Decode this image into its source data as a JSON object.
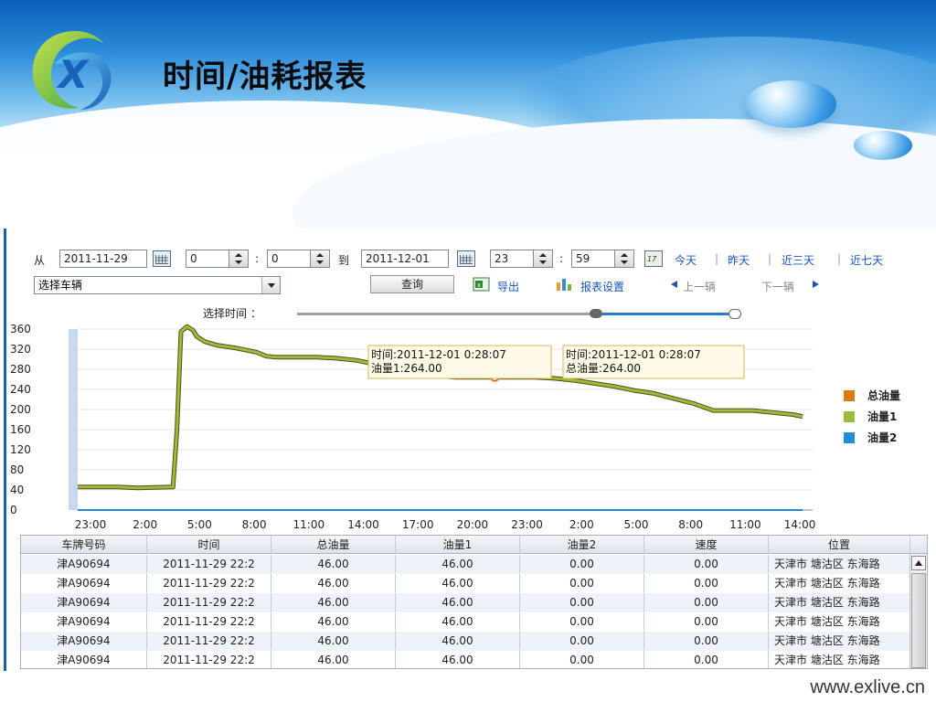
{
  "header": {
    "title": "时间/油耗报表",
    "logo_letter": "X"
  },
  "filter": {
    "from_label": "从",
    "start_date": "2011-11-29",
    "start_hour": "0",
    "start_minute": "0",
    "colon": ":",
    "to_label": "到",
    "end_date": "2011-12-01",
    "end_hour": "23",
    "end_minute": "59",
    "quick_links": [
      "今天",
      "昨天",
      "近三天",
      "近七天"
    ],
    "vehicle_placeholder": "选择车辆",
    "query_label": "查询",
    "export_label": "导出",
    "report_settings_label": "报表设置",
    "prev_vehicle_label": "上一辆",
    "next_vehicle_label": "下一辆",
    "time_slider_label": "选择时间 ："
  },
  "tooltips": [
    {
      "time": "时间:2011-12-01 0:28:07",
      "value": "油量1:264.00"
    },
    {
      "time": "时间:2011-12-01 0:28:07",
      "value": "总油量:264.00"
    }
  ],
  "chart_data": {
    "type": "line",
    "xlabels": [
      "23:00",
      "2:00",
      "5:00",
      "8:00",
      "11:00",
      "14:00",
      "17:00",
      "20:00",
      "23:00",
      "2:00",
      "5:00",
      "8:00",
      "11:00",
      "14:00"
    ],
    "yticks": [
      0,
      40,
      80,
      120,
      160,
      200,
      240,
      280,
      320,
      360
    ],
    "ylim": [
      0,
      360
    ],
    "legend_position": "right",
    "series": [
      {
        "name": "总油量",
        "color": "#e07b12",
        "values": [
          [
            0,
            46
          ],
          [
            1,
            46
          ],
          [
            2,
            46
          ],
          [
            3,
            44
          ],
          [
            4.8,
            46
          ],
          [
            5.0,
            160
          ],
          [
            5.2,
            355
          ],
          [
            5.5,
            365
          ],
          [
            5.8,
            358
          ],
          [
            6.0,
            345
          ],
          [
            6.4,
            335
          ],
          [
            7,
            328
          ],
          [
            8,
            322
          ],
          [
            9,
            314
          ],
          [
            9.5,
            306
          ],
          [
            10,
            304
          ],
          [
            11,
            304
          ],
          [
            12,
            304
          ],
          [
            13,
            302
          ],
          [
            14,
            298
          ],
          [
            15,
            290
          ],
          [
            16,
            282
          ],
          [
            17,
            274
          ],
          [
            18,
            268
          ],
          [
            19,
            264
          ],
          [
            20,
            264
          ],
          [
            21,
            264
          ],
          [
            22,
            264
          ],
          [
            23,
            264
          ],
          [
            24,
            262
          ],
          [
            25,
            258
          ],
          [
            26,
            252
          ],
          [
            27,
            246
          ],
          [
            28,
            238
          ],
          [
            29,
            232
          ],
          [
            30,
            222
          ],
          [
            31,
            212
          ],
          [
            32,
            198
          ],
          [
            33,
            198
          ],
          [
            34,
            198
          ],
          [
            35,
            194
          ],
          [
            36,
            190
          ],
          [
            36.5,
            186
          ]
        ]
      },
      {
        "name": "油量1",
        "color": "#9bbb3b",
        "values": [
          [
            0,
            46
          ],
          [
            1,
            46
          ],
          [
            2,
            46
          ],
          [
            3,
            44
          ],
          [
            4.8,
            46
          ],
          [
            5.0,
            160
          ],
          [
            5.2,
            355
          ],
          [
            5.5,
            365
          ],
          [
            5.8,
            358
          ],
          [
            6.0,
            345
          ],
          [
            6.4,
            335
          ],
          [
            7,
            328
          ],
          [
            8,
            322
          ],
          [
            9,
            314
          ],
          [
            9.5,
            306
          ],
          [
            10,
            304
          ],
          [
            11,
            304
          ],
          [
            12,
            304
          ],
          [
            13,
            302
          ],
          [
            14,
            298
          ],
          [
            15,
            290
          ],
          [
            16,
            282
          ],
          [
            17,
            274
          ],
          [
            18,
            268
          ],
          [
            19,
            264
          ],
          [
            20,
            264
          ],
          [
            21,
            264
          ],
          [
            22,
            264
          ],
          [
            23,
            264
          ],
          [
            24,
            262
          ],
          [
            25,
            258
          ],
          [
            26,
            252
          ],
          [
            27,
            246
          ],
          [
            28,
            238
          ],
          [
            29,
            232
          ],
          [
            30,
            222
          ],
          [
            31,
            212
          ],
          [
            32,
            198
          ],
          [
            33,
            198
          ],
          [
            34,
            198
          ],
          [
            35,
            194
          ],
          [
            36,
            190
          ],
          [
            36.5,
            186
          ]
        ]
      },
      {
        "name": "油量2",
        "color": "#1f8fd8",
        "values": [
          [
            0,
            0
          ],
          [
            36.5,
            0
          ]
        ]
      }
    ]
  },
  "table": {
    "columns": [
      "车牌号码",
      "时间",
      "总油量",
      "油量1",
      "油量2",
      "速度",
      "位置"
    ],
    "rows": [
      [
        "津A90694",
        "2011-11-29 22:2",
        "46.00",
        "46.00",
        "0.00",
        "0.00",
        "天津市 塘沽区 东海路"
      ],
      [
        "津A90694",
        "2011-11-29 22:2",
        "46.00",
        "46.00",
        "0.00",
        "0.00",
        "天津市 塘沽区 东海路"
      ],
      [
        "津A90694",
        "2011-11-29 22:2",
        "46.00",
        "46.00",
        "0.00",
        "0.00",
        "天津市 塘沽区 东海路"
      ],
      [
        "津A90694",
        "2011-11-29 22:2",
        "46.00",
        "46.00",
        "0.00",
        "0.00",
        "天津市 塘沽区 东海路"
      ],
      [
        "津A90694",
        "2011-11-29 22:2",
        "46.00",
        "46.00",
        "0.00",
        "0.00",
        "天津市 塘沽区 东海路"
      ],
      [
        "津A90694",
        "2011-11-29 22:2",
        "46.00",
        "46.00",
        "0.00",
        "0.00",
        "天津市 塘沽区 东海路"
      ]
    ]
  },
  "footer": {
    "url": "www.exlive.cn"
  },
  "icons": {
    "calendar": "calendar-icon",
    "today_calendar": "calendar-17-icon",
    "export": "excel-icon",
    "report": "bar-chart-icon",
    "prev": "triangle-left-icon",
    "next": "triangle-right-icon"
  },
  "colors": {
    "link": "#1a56b8",
    "frame": "#1f5fa8",
    "banner": "#2a8ad8"
  }
}
